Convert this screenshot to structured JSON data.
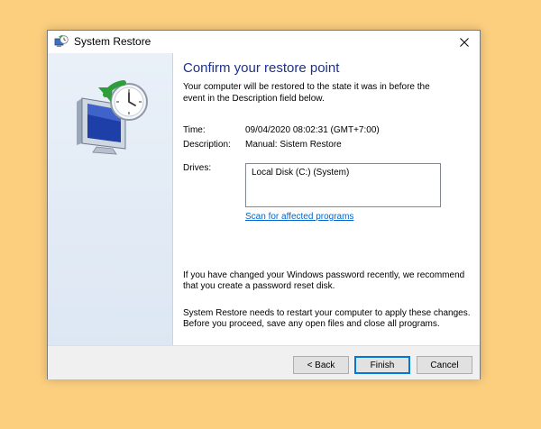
{
  "window": {
    "title": "System Restore",
    "icons": {
      "title": "system-restore-icon",
      "close": "close-icon",
      "art": "monitor-clock-restore-icon"
    }
  },
  "content": {
    "heading": "Confirm your restore point",
    "intro": "Your computer will be restored to the state it was in before the event in the Description field below.",
    "time_label": "Time:",
    "time_value": "09/04/2020 08:02:31 (GMT+7:00)",
    "description_label": "Description:",
    "description_value": "Manual: Sistem Restore",
    "drives_label": "Drives:",
    "drives": [
      "Local Disk (C:) (System)"
    ],
    "scan_link": "Scan for affected programs",
    "password_note": "If you have changed your Windows password recently, we recommend that you create a password reset disk.",
    "restart_note": "System Restore needs to restart your computer to apply these changes. Before you proceed, save any open files and close all programs."
  },
  "buttons": {
    "back": "< Back",
    "finish": "Finish",
    "cancel": "Cancel"
  },
  "colors": {
    "desktop": "#FCCF7F",
    "heading": "#1E3287",
    "link": "#0066CC",
    "side_panel": "#E4ECF6",
    "primary_border": "#0078D7"
  }
}
